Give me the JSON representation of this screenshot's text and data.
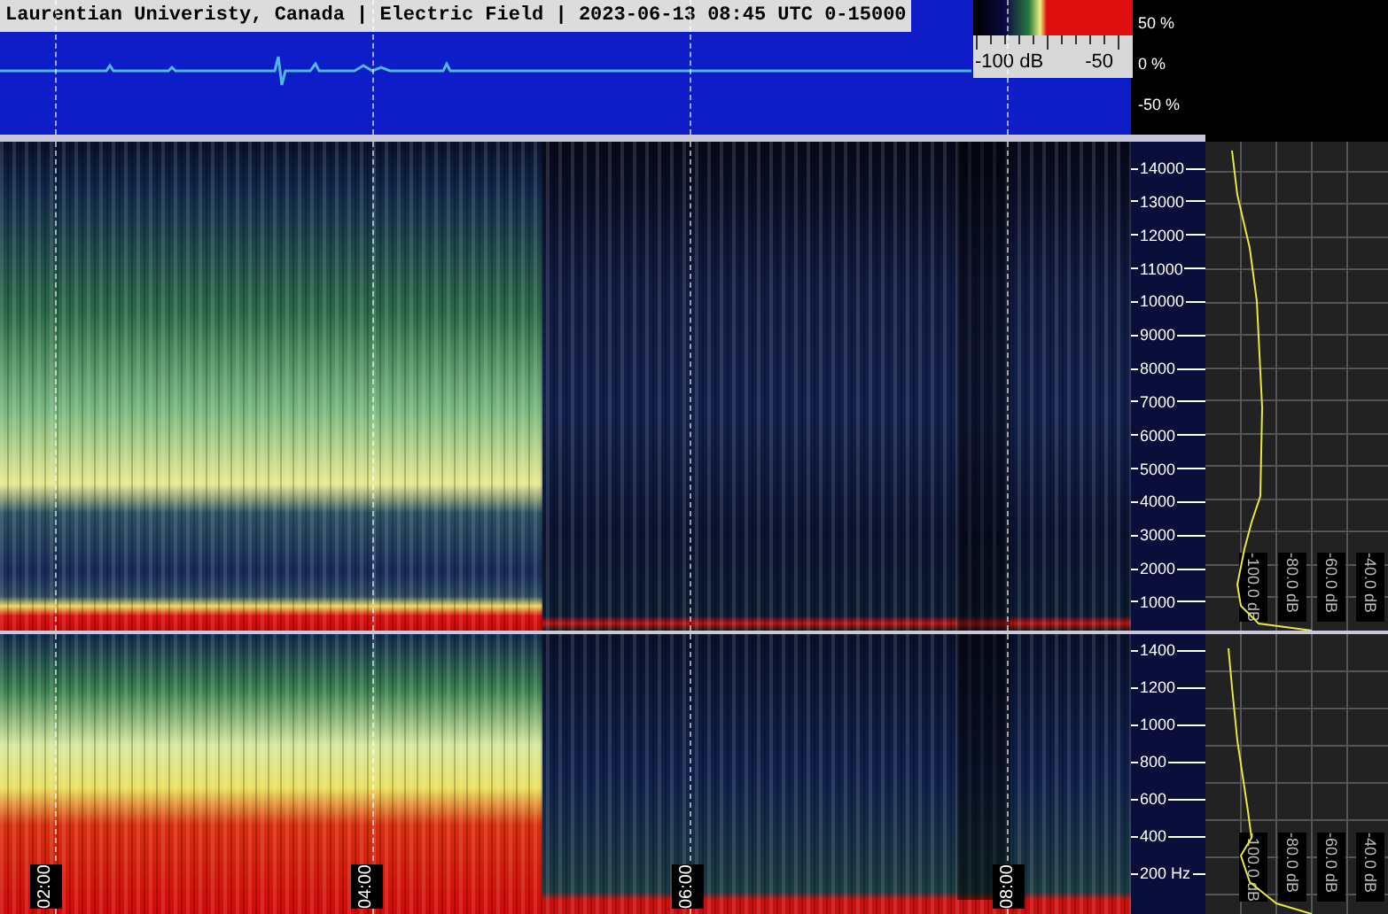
{
  "title": "Laurentian Univeristy, Canada | Electric Field | 2023-06-13 08:45 UTC 0-15000",
  "color_scale": {
    "min_label": "-100 dB",
    "mid_label": "-50"
  },
  "waveform_axis": [
    "50 %",
    "0 %",
    "-50 %"
  ],
  "upper_axis": [
    "14000",
    "13000",
    "12000",
    "11000",
    "10000",
    "9000",
    "8000",
    "7000",
    "6000",
    "5000",
    "4000",
    "3000",
    "2000",
    "1000"
  ],
  "lower_axis": [
    "1400",
    "1200",
    "1000",
    "800",
    "600",
    "400",
    "200 Hz"
  ],
  "time_labels": [
    "02:00",
    "04:00",
    "06:00",
    "08:00"
  ],
  "upper_db_labels": [
    "-100.0 dB",
    "-80.0 dB",
    "-60.0 dB",
    "-40.0 dB"
  ],
  "lower_db_labels": [
    "-100.0 dB",
    "-80.0 dB",
    "-60.0 dB",
    "-40.0 dB"
  ]
}
